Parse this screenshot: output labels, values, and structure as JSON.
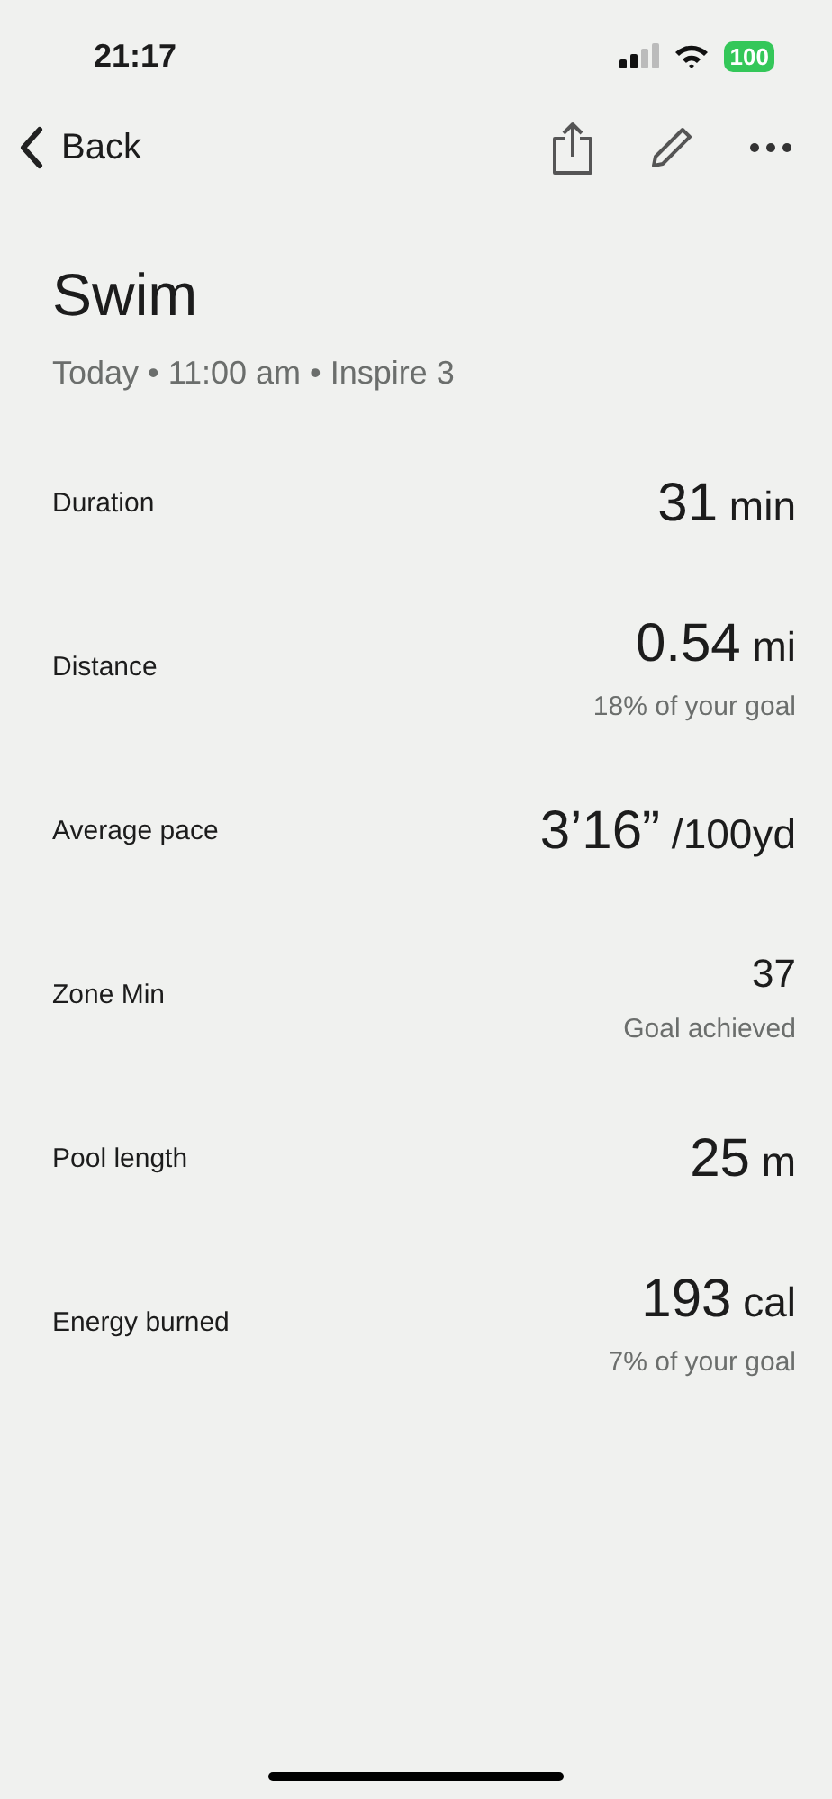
{
  "status_bar": {
    "time": "21:17",
    "battery": "100"
  },
  "nav": {
    "back": "Back"
  },
  "title": "Swim",
  "subtitle": "Today • 11:00 am • Inspire 3",
  "stats": [
    {
      "label": "Duration",
      "kind": "big",
      "value": "31",
      "unit": "min"
    },
    {
      "label": "Distance",
      "kind": "big",
      "value": "0.54",
      "unit": "mi",
      "note": "18% of your goal"
    },
    {
      "label": "Average pace",
      "kind": "big",
      "value": "3’16”",
      "unit": "/100yd"
    },
    {
      "label": "Zone Min",
      "kind": "small",
      "value": "37",
      "note": "Goal achieved"
    },
    {
      "label": "Pool length",
      "kind": "big",
      "value": "25",
      "unit": "m"
    },
    {
      "label": "Energy burned",
      "kind": "big",
      "value": "193",
      "unit": "cal",
      "note": "7% of your goal"
    }
  ]
}
